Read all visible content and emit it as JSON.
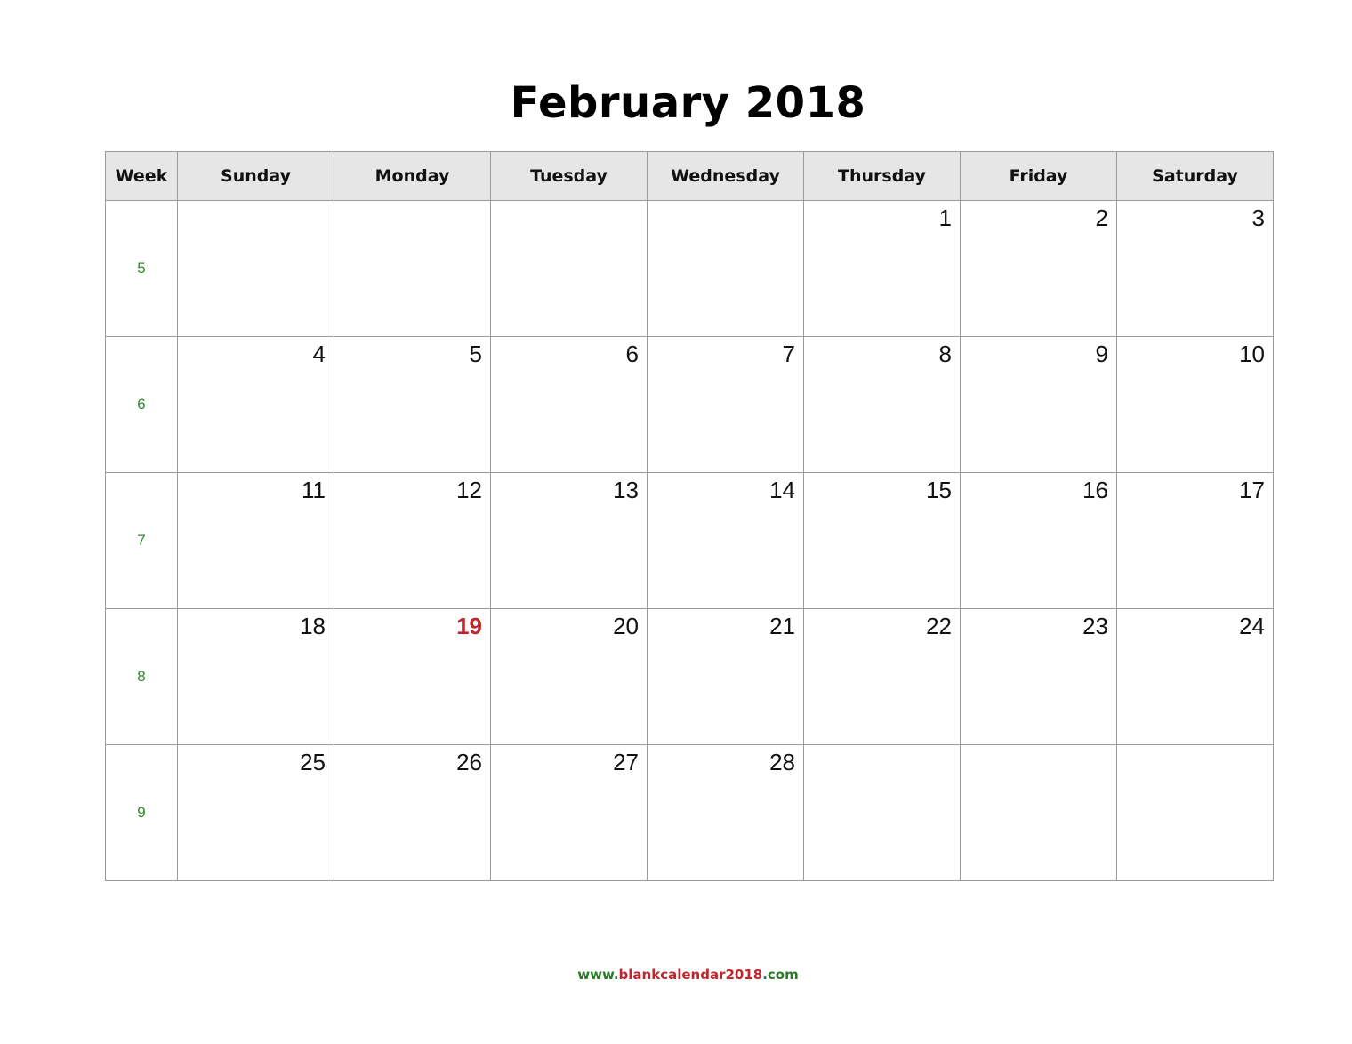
{
  "title": "February 2018",
  "headers": [
    "Week",
    "Sunday",
    "Monday",
    "Tuesday",
    "Wednesday",
    "Thursday",
    "Friday",
    "Saturday"
  ],
  "weeks": [
    {
      "week": "5",
      "days": [
        "",
        "",
        "",
        "",
        "1",
        "2",
        "3"
      ]
    },
    {
      "week": "6",
      "days": [
        "4",
        "5",
        "6",
        "7",
        "8",
        "9",
        "10"
      ]
    },
    {
      "week": "7",
      "days": [
        "11",
        "12",
        "13",
        "14",
        "15",
        "16",
        "17"
      ]
    },
    {
      "week": "8",
      "days": [
        "18",
        "19",
        "20",
        "21",
        "22",
        "23",
        "24"
      ]
    },
    {
      "week": "9",
      "days": [
        "25",
        "26",
        "27",
        "28",
        "",
        "",
        ""
      ]
    }
  ],
  "highlighted_day": "19",
  "colors": {
    "week_number": "#2a8a2a",
    "holiday": "#c0262c",
    "header_bg": "#e6e6e6"
  },
  "footer": {
    "prefix": "www.",
    "middle": "blankcalendar2018",
    "suffix": ".com"
  }
}
